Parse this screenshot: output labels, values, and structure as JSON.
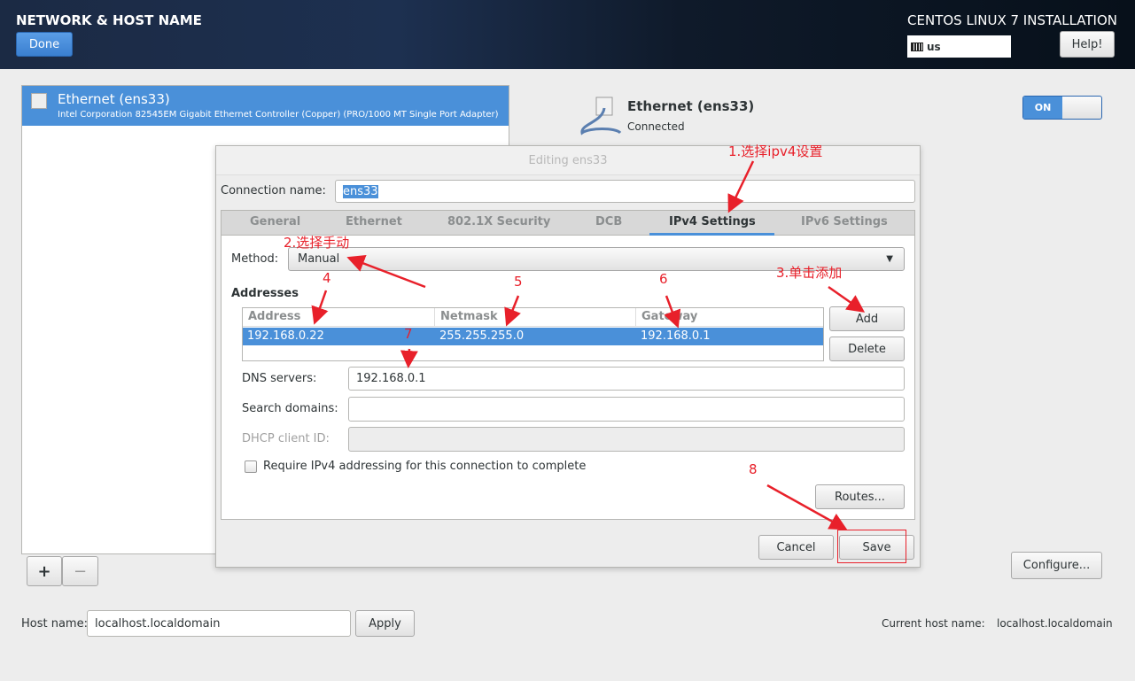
{
  "header": {
    "title": "NETWORK & HOST NAME",
    "done_label": "Done",
    "product": "CENTOS LINUX 7 INSTALLATION",
    "keyboard_layout": "us",
    "help_label": "Help!"
  },
  "device_list": {
    "items": [
      {
        "name": "Ethernet (ens33)",
        "description": "Intel Corporation 82545EM Gigabit Ethernet Controller (Copper) (PRO/1000 MT Single Port Adapter)"
      }
    ],
    "add_label": "+",
    "remove_label": "−"
  },
  "device_detail": {
    "name": "Ethernet (ens33)",
    "status": "Connected",
    "toggle": "ON",
    "configure_label": "Configure..."
  },
  "dialog": {
    "title": "Editing ens33",
    "connection_name_label": "Connection name:",
    "connection_name": "ens33",
    "tabs": [
      "General",
      "Ethernet",
      "802.1X Security",
      "DCB",
      "IPv4 Settings",
      "IPv6 Settings"
    ],
    "active_tab": "IPv4 Settings",
    "method_label": "Method:",
    "method": "Manual",
    "addresses_label": "Addresses",
    "columns": [
      "Address",
      "Netmask",
      "Gateway"
    ],
    "rows": [
      [
        "192.168.0.22",
        "255.255.255.0",
        "192.168.0.1"
      ]
    ],
    "add_label": "Add",
    "delete_label": "Delete",
    "dns_label": "DNS servers:",
    "dns_value": "192.168.0.1",
    "search_label": "Search domains:",
    "search_value": "",
    "dhcp_label": "DHCP client ID:",
    "dhcp_value": "",
    "require_label": "Require IPv4 addressing for this connection to complete",
    "require_checked": false,
    "routes_label": "Routes...",
    "cancel_label": "Cancel",
    "save_label": "Save"
  },
  "hostname": {
    "label": "Host name:",
    "value": "localhost.localdomain",
    "apply_label": "Apply",
    "current_label": "Current host name:",
    "current_value": "localhost.localdomain"
  },
  "annotations": [
    "1.选择ipv4设置",
    "2.选择手动",
    "3.单击添加",
    "4",
    "5",
    "6",
    "7",
    "8"
  ],
  "colors": {
    "accent": "#4a90d9",
    "annotation": "#e8202a",
    "header": "#1b2a44"
  }
}
